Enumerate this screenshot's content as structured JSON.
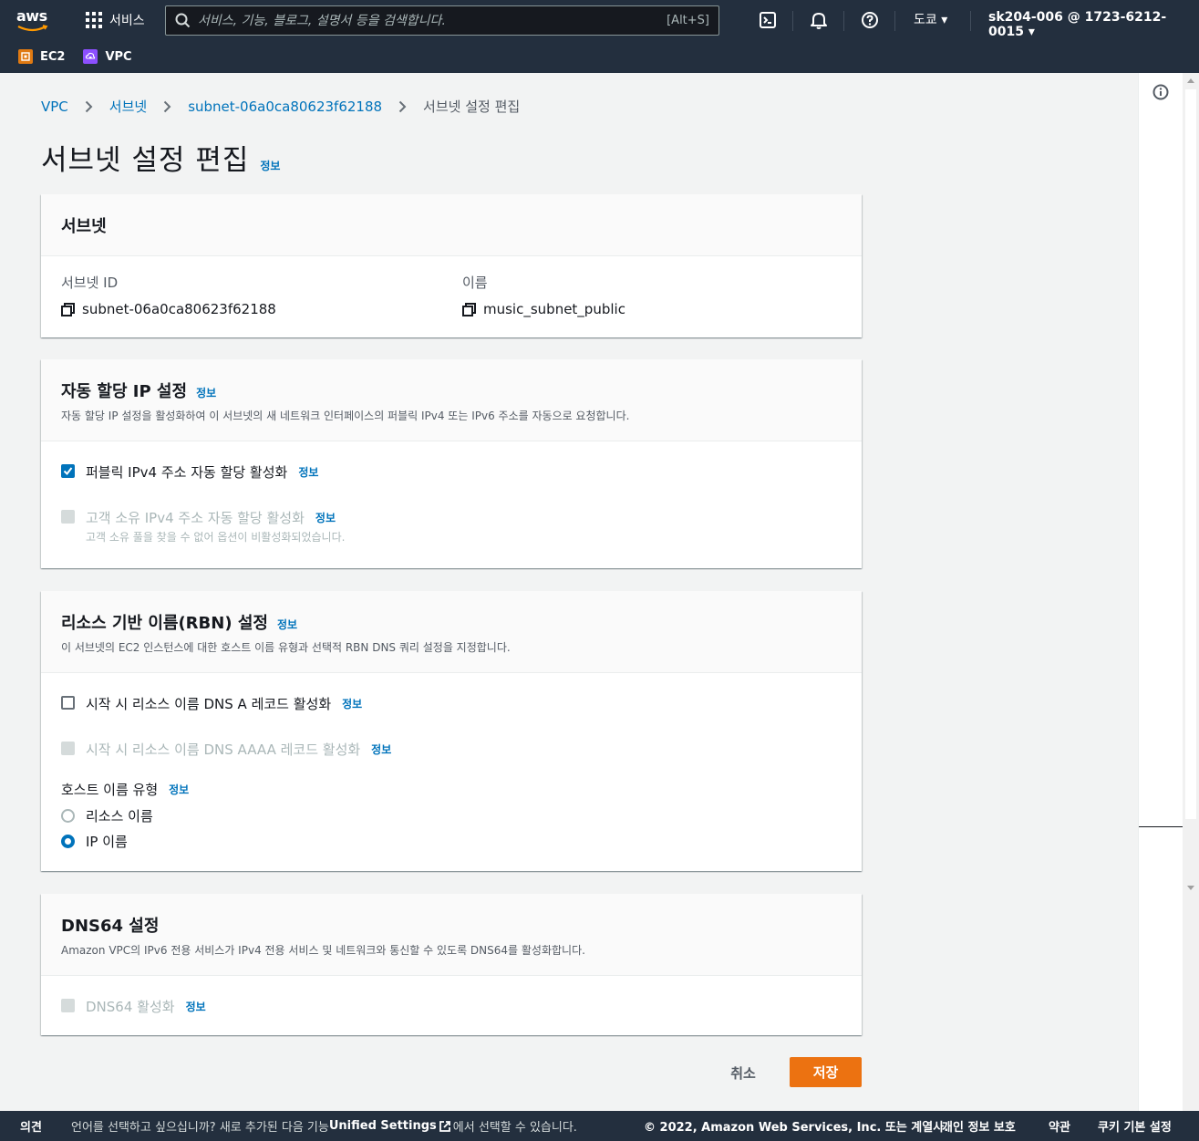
{
  "topnav": {
    "logo_text": "aws",
    "services_label": "서비스",
    "search_placeholder": "서비스, 기능, 블로그, 설명서 등을 검색합니다.",
    "search_shortcut": "[Alt+S]",
    "region": "도쿄 ▾",
    "account": "sk204-006 @ 1723-6212-0015 ▾",
    "favorites": [
      {
        "label": "EC2",
        "color": "#e07a12"
      },
      {
        "label": "VPC",
        "color": "#8c4fff"
      }
    ]
  },
  "breadcrumb": {
    "items": [
      "VPC",
      "서브넷",
      "subnet-06a0ca80623f62188"
    ],
    "current": "서브넷 설정 편집"
  },
  "page": {
    "title": "서브넷 설정 편집",
    "info": "정보"
  },
  "subnet_section": {
    "title": "서브넷",
    "id_label": "서브넷 ID",
    "id_value": "subnet-06a0ca80623f62188",
    "name_label": "이름",
    "name_value": "music_subnet_public"
  },
  "auto_ip_section": {
    "title": "자동 할당 IP 설정",
    "info": "정보",
    "description": "자동 할당 IP 설정을 활성화하여 이 서브넷의 새 네트워크 인터페이스의 퍼블릭 IPv4 또는 IPv6 주소를 자동으로 요청합니다.",
    "public_ipv4_label": "퍼블릭 IPv4 주소 자동 할당 활성화",
    "public_ipv4_checked": true,
    "customer_ipv4_label": "고객 소유 IPv4 주소 자동 할당 활성화",
    "customer_ipv4_sub": "고객 소유 풀을 찾을 수 없어 옵션이 비활성화되었습니다.",
    "info_link": "정보"
  },
  "rbn_section": {
    "title": "리소스 기반 이름(RBN) 설정",
    "info": "정보",
    "description": "이 서브넷의 EC2 인스턴스에 대한 호스트 이름 유형과 선택적 RBN DNS 쿼리 설정을 지정합니다.",
    "dns_a_label": "시작 시 리소스 이름 DNS A 레코드 활성화",
    "dns_aaaa_label": "시작 시 리소스 이름 DNS AAAA 레코드 활성화",
    "hostname_type_label": "호스트 이름 유형",
    "radio_resource_name": "리소스 이름",
    "radio_ip_name": "IP 이름",
    "selected": "IP 이름",
    "info_link": "정보"
  },
  "dns64_section": {
    "title": "DNS64 설정",
    "description": "Amazon VPC의 IPv6 전용 서비스가 IPv4 전용 서비스 및 네트워크와 통신할 수 있도록 DNS64를 활성화합니다.",
    "enable_label": "DNS64 활성화",
    "info_link": "정보"
  },
  "actions": {
    "cancel": "취소",
    "save": "저장"
  },
  "footer": {
    "feedback": "의견",
    "lang_prefix": "언어를 선택하고 싶으십니까? 새로 추가된 다음 기능",
    "lang_link": "Unified Settings",
    "lang_suffix": "에서 선택할 수 있습니다.",
    "copyright": "© 2022, Amazon Web Services, Inc. 또는 계열사.",
    "privacy": "개인 정보 보호",
    "terms": "약관",
    "cookies": "쿠키 기본 설정"
  }
}
